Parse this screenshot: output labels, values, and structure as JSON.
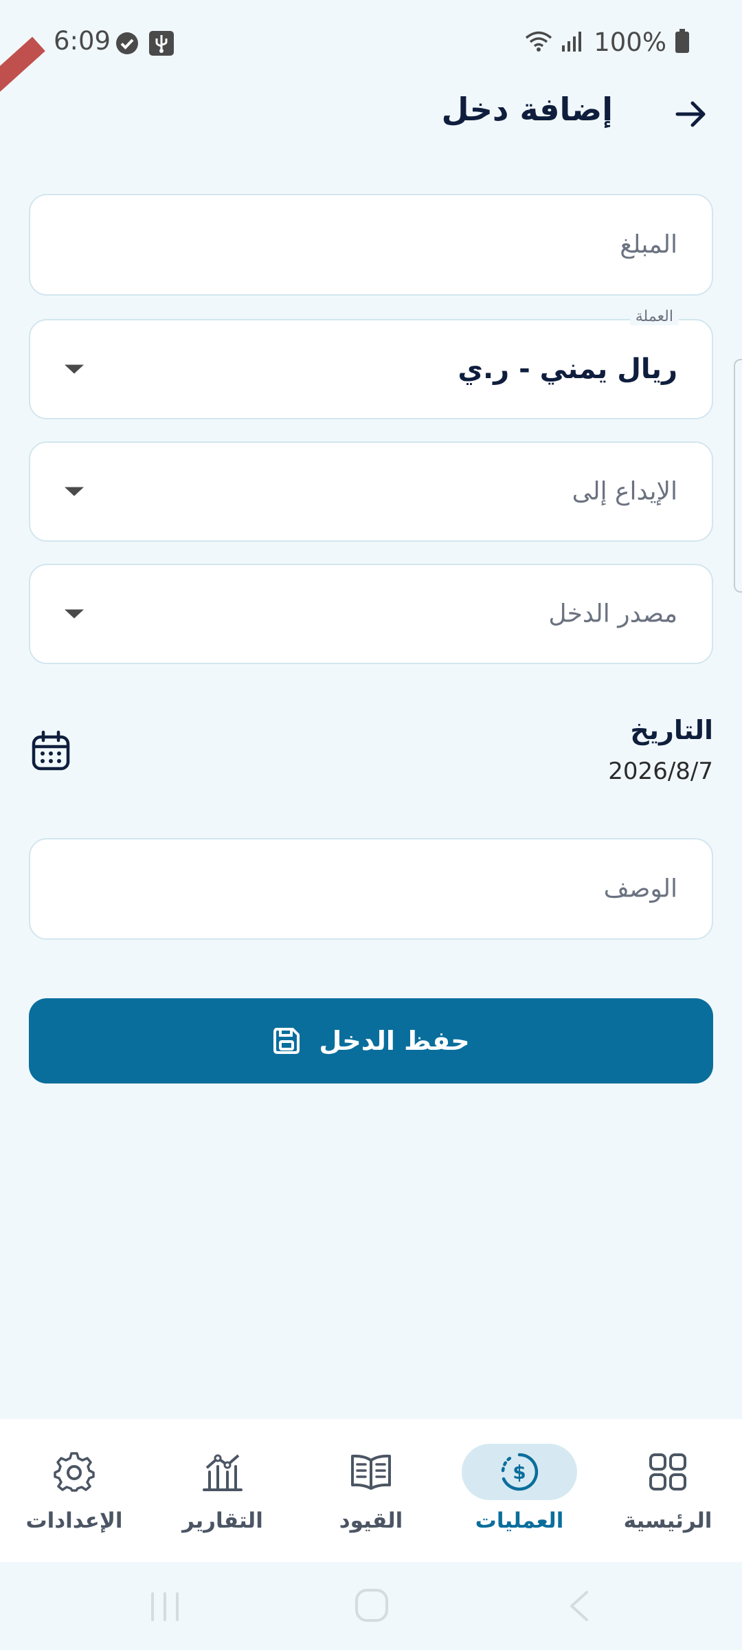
{
  "status_bar": {
    "time": "6:09",
    "battery": "100%"
  },
  "header": {
    "title": "إضافة دخل"
  },
  "form": {
    "amount_placeholder": "المبلغ",
    "currency_label": "العملة",
    "currency_value": "ريال يمني - ر.ي",
    "deposit_to_placeholder": "الإيداع إلى",
    "income_source_placeholder": "مصدر الدخل",
    "date_label": "التاريخ",
    "date_value": "2026/8/7",
    "description_placeholder": "الوصف",
    "save_label": "حفظ الدخل"
  },
  "bottom_nav": {
    "items": [
      {
        "label": "الرئيسية",
        "icon": "grid-icon",
        "active": false
      },
      {
        "label": "العمليات",
        "icon": "dollar-cycle-icon",
        "active": true
      },
      {
        "label": "القيود",
        "icon": "book-icon",
        "active": false
      },
      {
        "label": "التقارير",
        "icon": "chart-icon",
        "active": false
      },
      {
        "label": "الإعدادات",
        "icon": "gear-icon",
        "active": false
      }
    ]
  },
  "colors": {
    "primary": "#0a6e9c",
    "background": "#f1f8fb",
    "active_nav_bg": "#d6e9f2"
  }
}
